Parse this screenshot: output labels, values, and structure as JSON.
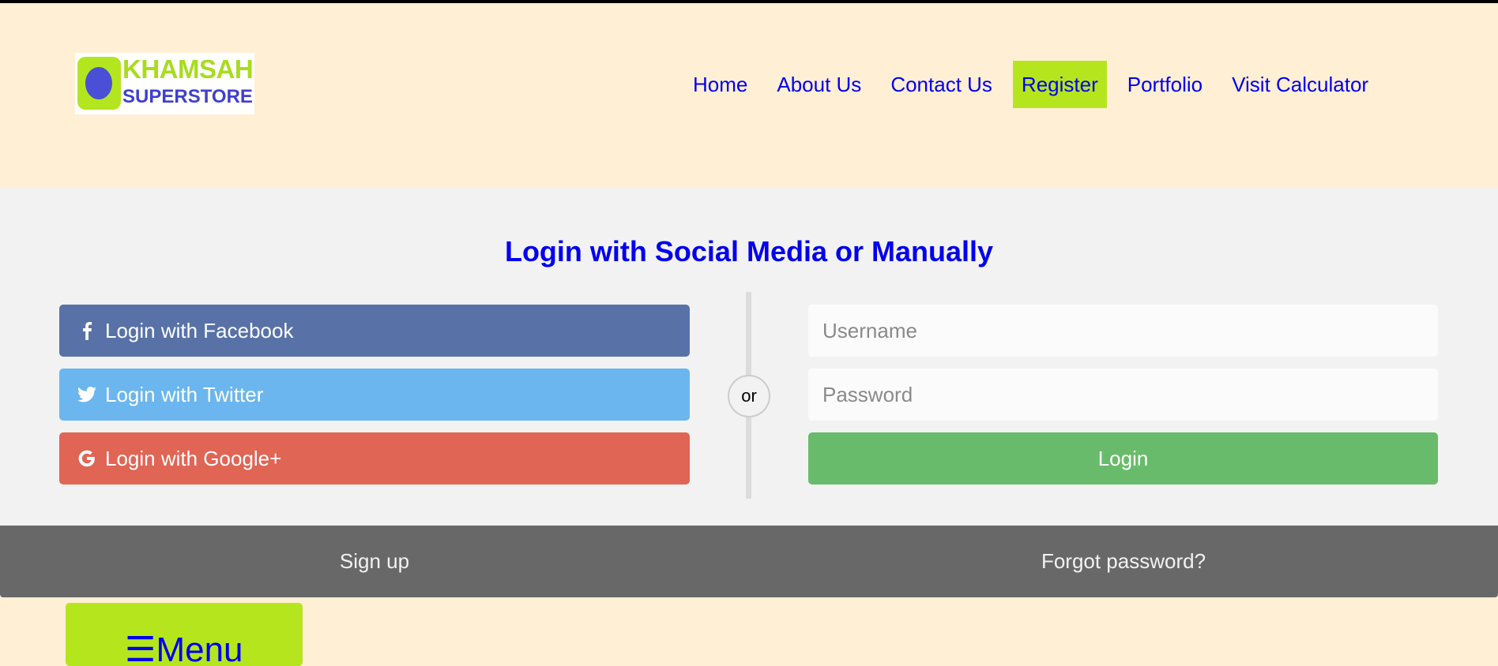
{
  "logo": {
    "top_text": "KHAMSAH",
    "bottom_text": "SUPERSTORE"
  },
  "nav": {
    "items": [
      {
        "label": "Home"
      },
      {
        "label": "About Us"
      },
      {
        "label": "Contact Us"
      },
      {
        "label": "Register",
        "active": true
      },
      {
        "label": "Portfolio"
      },
      {
        "label": "Visit Calculator"
      }
    ]
  },
  "login": {
    "title": "Login with Social Media or Manually",
    "facebook_label": "Login with Facebook",
    "twitter_label": "Login with Twitter",
    "google_label": "Login with Google+",
    "or_label": "or",
    "username_placeholder": "Username",
    "password_placeholder": "Password",
    "login_label": "Login"
  },
  "footer": {
    "signup_label": "Sign up",
    "forgot_label": "Forgot password?"
  },
  "menu": {
    "label": "☰Menu"
  },
  "colors": {
    "page_bg": "#ffefd5",
    "nav_active": "#b5e61d",
    "link": "#0000ee",
    "facebook": "#5872a8",
    "twitter": "#6bb6ee",
    "google": "#e06555",
    "login": "#68bb6a",
    "bottom_bar": "#686868"
  }
}
